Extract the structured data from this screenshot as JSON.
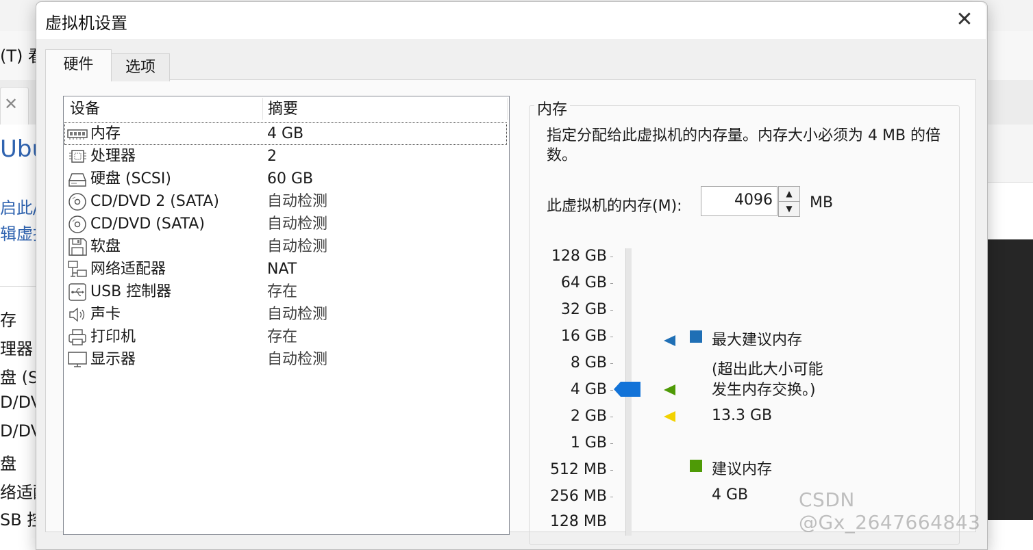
{
  "background_app": {
    "menu_fragment": "(T)  看",
    "title_fragment": "Ubu",
    "links": [
      "启此/",
      "辑虚拟"
    ],
    "items": [
      "存",
      "理器",
      "盘 (S",
      "D/DV",
      "D/DV",
      "盘",
      "络适配",
      "SB 控"
    ]
  },
  "dialog": {
    "title": "虚拟机设置",
    "close_glyph": "✕",
    "tabs": [
      {
        "label": "硬件",
        "active": true
      },
      {
        "label": "选项",
        "active": false
      }
    ]
  },
  "device_list": {
    "columns": [
      "设备",
      "摘要"
    ],
    "rows": [
      {
        "icon": "memory-icon",
        "device": "内存",
        "summary": "4 GB",
        "selected": true
      },
      {
        "icon": "processor-icon",
        "device": "处理器",
        "summary": "2"
      },
      {
        "icon": "hard-disk-icon",
        "device": "硬盘 (SCSI)",
        "summary": "60 GB"
      },
      {
        "icon": "cd-dvd-icon",
        "device": "CD/DVD 2 (SATA)",
        "summary": "自动检测"
      },
      {
        "icon": "cd-dvd-icon",
        "device": "CD/DVD (SATA)",
        "summary": "自动检测"
      },
      {
        "icon": "floppy-icon",
        "device": "软盘",
        "summary": "自动检测"
      },
      {
        "icon": "network-adapter-icon",
        "device": "网络适配器",
        "summary": "NAT"
      },
      {
        "icon": "usb-icon",
        "device": "USB 控制器",
        "summary": "存在"
      },
      {
        "icon": "sound-card-icon",
        "device": "声卡",
        "summary": "自动检测"
      },
      {
        "icon": "printer-icon",
        "device": "打印机",
        "summary": "存在"
      },
      {
        "icon": "display-icon",
        "device": "显示器",
        "summary": "自动检测"
      }
    ]
  },
  "memory": {
    "group_title": "内存",
    "description": "指定分配给此虚拟机的内存量。内存大小必须为 4 MB 的倍数。",
    "field_label": "此虚拟机的内存(M):",
    "value": "4096",
    "unit": "MB",
    "scale_labels": [
      "128 GB",
      "64 GB",
      "32 GB",
      "16 GB",
      "8 GB",
      "4 GB",
      "2 GB",
      "1 GB",
      "512 MB",
      "256 MB",
      "128 MB"
    ],
    "current_scale_label": "4 GB",
    "max_recommended": {
      "label": "最大建议内存",
      "note_line1": "(超出此大小可能",
      "note_line2": "发生内存交换。)",
      "value": "13.3 GB",
      "color": "#1f6fb5"
    },
    "recommended": {
      "label": "建议内存",
      "value": "4 GB",
      "color": "#4e9a06"
    },
    "guest_min_color": "#f2d200",
    "slider_color": "#1273d8"
  },
  "watermark": "CSDN @Gx_2647664843"
}
